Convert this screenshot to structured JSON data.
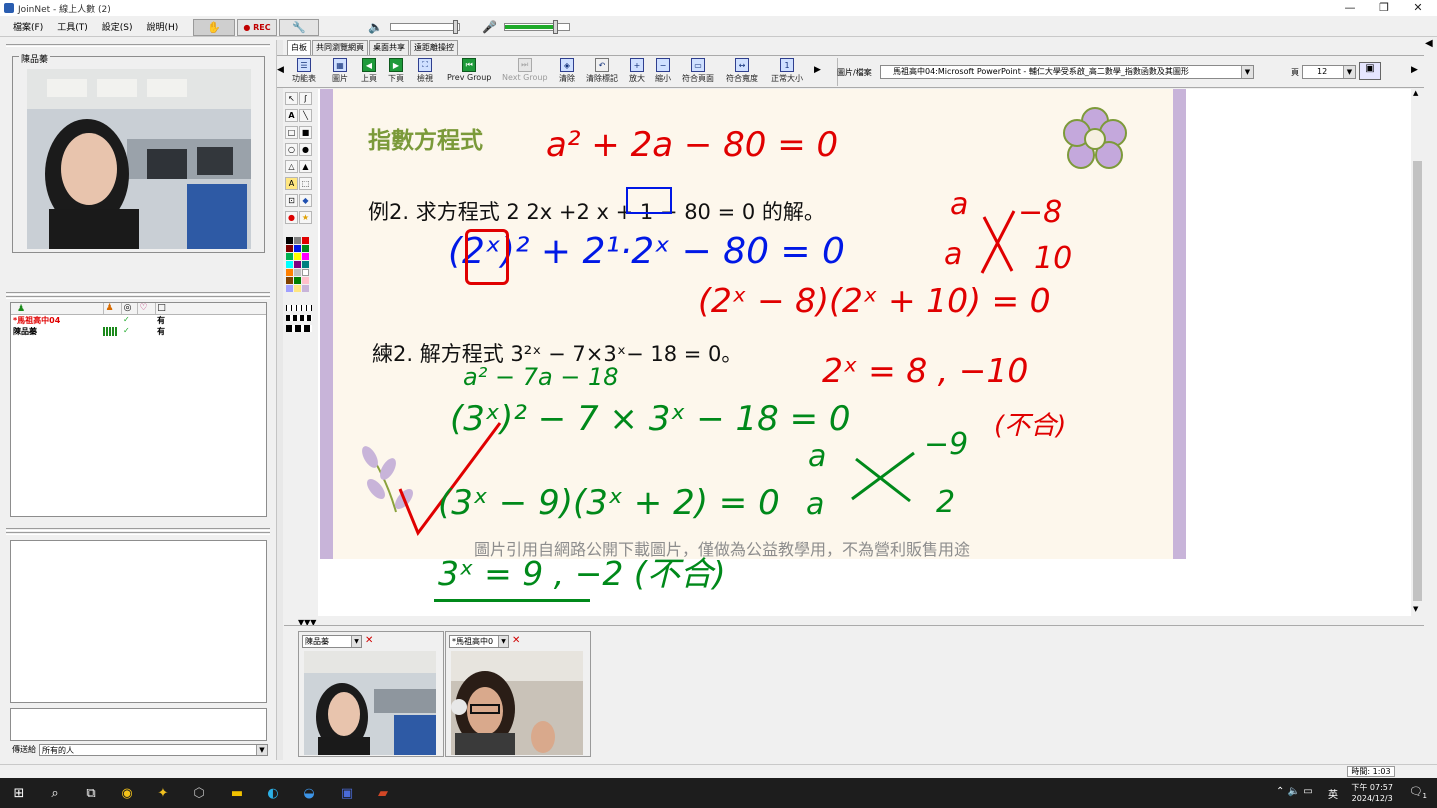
{
  "window": {
    "title": "JoinNet - 線上人數 (2)"
  },
  "menu": {
    "items": [
      "檔案(F)",
      "工具(T)",
      "設定(S)",
      "說明(H)"
    ],
    "rec_label": "● REC"
  },
  "left_panel": {
    "video_label": "陳品蓁",
    "user_list": {
      "rows": [
        {
          "name": "*馬祖高中04",
          "status": "有",
          "color": "#e00000"
        },
        {
          "name": "陳品蓁",
          "status": "有",
          "color": "#000000"
        }
      ]
    },
    "send_to_label": "傳送給",
    "send_to_value": "所有的人"
  },
  "tabs": [
    "白板",
    "共同瀏覽網頁",
    "桌面共享",
    "遠距離操控"
  ],
  "toolbar": {
    "buttons": [
      {
        "label": "功能表",
        "icon": "menu-icon",
        "enabled": true
      },
      {
        "label": "圖片",
        "icon": "image-icon",
        "enabled": true
      },
      {
        "label": "上頁",
        "icon": "prev-page-icon",
        "enabled": true
      },
      {
        "label": "下頁",
        "icon": "next-page-icon",
        "enabled": true
      },
      {
        "label": "檢視",
        "icon": "view-icon",
        "enabled": true
      },
      {
        "label": "Prev Group",
        "icon": "prev-group-icon",
        "enabled": true
      },
      {
        "label": "Next Group",
        "icon": "next-group-icon",
        "enabled": false
      },
      {
        "label": "清除",
        "icon": "clear-icon",
        "enabled": true
      },
      {
        "label": "清除標記",
        "icon": "clear-marks-icon",
        "enabled": true
      },
      {
        "label": "放大",
        "icon": "zoom-in-icon",
        "enabled": true
      },
      {
        "label": "縮小",
        "icon": "zoom-out-icon",
        "enabled": true
      },
      {
        "label": "符合頁面",
        "icon": "fit-page-icon",
        "enabled": true
      },
      {
        "label": "符合寬度",
        "icon": "fit-width-icon",
        "enabled": true
      },
      {
        "label": "正常大小",
        "icon": "normal-size-icon",
        "enabled": true
      }
    ],
    "file_label": "圖片/檔案",
    "file_value": "馬祖高中04:Microsoft PowerPoint - 輔仁大學受系啟_高二數學_指數函數及其圖形",
    "page_label": "頁",
    "page_value": "12"
  },
  "slide": {
    "title": "指數方程式",
    "example": "例2. 求方程式 2 2x +2 x + 1 − 80 = 0 的解。",
    "practice": "練2. 解方程式 3²ˣ − 7×3ˣ− 18 = 0。",
    "footer_note": "圖片引用自網路公開下載圖片，僅做為公益教學用，不為營利販售用途"
  },
  "handwriting": {
    "red_top": "a² + 2a − 80 = 0",
    "red_factor_a1": "a",
    "red_factor_a2": "a",
    "red_factor_n1": "−8",
    "red_factor_n2": "10",
    "blue_line": "(2ˣ)² + 2¹·2ˣ − 80 = 0",
    "red_factored": "(2ˣ − 8)(2ˣ + 10) = 0",
    "red_result": "2ˣ = 8 , −10",
    "red_reject": "(不合)",
    "green_sub": "a² − 7a − 18",
    "green_line": "(3ˣ)² − 7 × 3ˣ − 18 = 0",
    "green_factor_a1": "a",
    "green_factor_a2": "a",
    "green_factor_n1": "−9",
    "green_factor_n2": "2",
    "green_factored": "(3ˣ − 9)(3ˣ + 2) = 0",
    "green_result": "3ˣ = 9 , −2 (不合)"
  },
  "thumbnails": [
    {
      "name": "陳品蓁"
    },
    {
      "name": "*馬祖高中0"
    }
  ],
  "statusbar": {
    "clock": "時間: 1:03"
  },
  "taskbar": {
    "time": "下午 07:57",
    "date": "2024/12/3",
    "lang": "英",
    "notif": "1"
  }
}
